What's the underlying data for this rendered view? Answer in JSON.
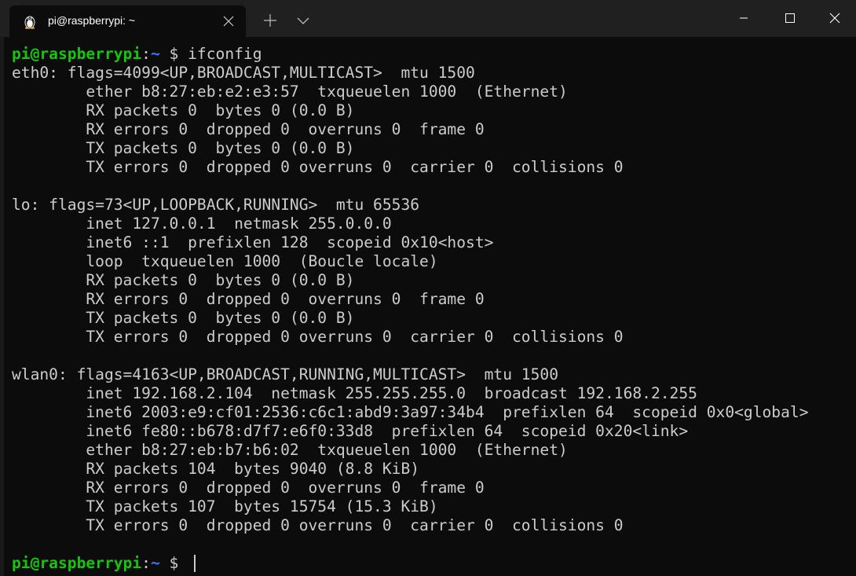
{
  "window": {
    "tab_title": "pi@raspberrypi: ~",
    "tab_icon": "linux-tux-icon",
    "new_tab_icon": "plus-icon",
    "dropdown_icon": "chevron-down-icon",
    "controls": [
      "minimize-icon",
      "maximize-icon",
      "close-icon"
    ]
  },
  "colors": {
    "background": "#0c0c0c",
    "titlebar": "#202020",
    "text": "#cccccc",
    "prompt_user": "#16c60c",
    "prompt_path": "#3b78ff"
  },
  "prompt": {
    "user_host": "pi@raspberrypi",
    "colon": ":",
    "path": "~",
    "dollar": " $ "
  },
  "command": "ifconfig",
  "output": [
    "eth0: flags=4099<UP,BROADCAST,MULTICAST>  mtu 1500",
    "        ether b8:27:eb:e2:e3:57  txqueuelen 1000  (Ethernet)",
    "        RX packets 0  bytes 0 (0.0 B)",
    "        RX errors 0  dropped 0  overruns 0  frame 0",
    "        TX packets 0  bytes 0 (0.0 B)",
    "        TX errors 0  dropped 0 overruns 0  carrier 0  collisions 0",
    "",
    "lo: flags=73<UP,LOOPBACK,RUNNING>  mtu 65536",
    "        inet 127.0.0.1  netmask 255.0.0.0",
    "        inet6 ::1  prefixlen 128  scopeid 0x10<host>",
    "        loop  txqueuelen 1000  (Boucle locale)",
    "        RX packets 0  bytes 0 (0.0 B)",
    "        RX errors 0  dropped 0  overruns 0  frame 0",
    "        TX packets 0  bytes 0 (0.0 B)",
    "        TX errors 0  dropped 0 overruns 0  carrier 0  collisions 0",
    "",
    "wlan0: flags=4163<UP,BROADCAST,RUNNING,MULTICAST>  mtu 1500",
    "        inet 192.168.2.104  netmask 255.255.255.0  broadcast 192.168.2.255",
    "        inet6 2003:e9:cf01:2536:c6c1:abd9:3a97:34b4  prefixlen 64  scopeid 0x0<global>",
    "        inet6 fe80::b678:d7f7:e6f0:33d8  prefixlen 64  scopeid 0x20<link>",
    "        ether b8:27:eb:b7:b6:02  txqueuelen 1000  (Ethernet)",
    "        RX packets 104  bytes 9040 (8.8 KiB)",
    "        RX errors 0  dropped 0  overruns 0  frame 0",
    "        TX packets 107  bytes 15754 (15.3 KiB)",
    "        TX errors 0  dropped 0 overruns 0  carrier 0  collisions 0",
    ""
  ]
}
